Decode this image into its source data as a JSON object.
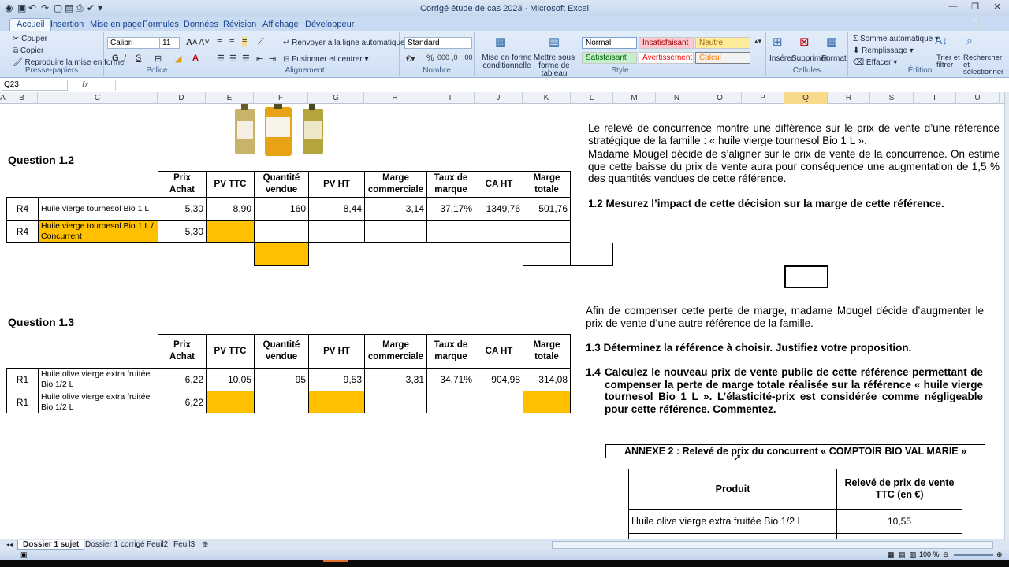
{
  "window": {
    "title": "Corrigé étude de cas 2023 - Microsoft Excel"
  },
  "tabs": [
    "Accueil",
    "Insertion",
    "Mise en page",
    "Formules",
    "Données",
    "Révision",
    "Affichage",
    "Développeur"
  ],
  "ribbon": {
    "clipboard": {
      "cut": "Couper",
      "copy": "Copier",
      "format_painter": "Reproduire la mise en forme",
      "label": "Presse-papiers"
    },
    "font": {
      "name": "Calibri",
      "size": "11",
      "label": "Police"
    },
    "alignment": {
      "wrap": "Renvoyer à la ligne automatiquement",
      "merge": "Fusionner et centrer",
      "label": "Alignement"
    },
    "number": {
      "format": "Standard",
      "label": "Nombre"
    },
    "conditional": "Mise en forme conditionnelle",
    "format_table": "Mettre sous forme de tableau",
    "styles": {
      "normal": "Normal",
      "insatisfaisant": "Insatisfaisant",
      "neutre": "Neutre",
      "satisfaisant": "Satisfaisant",
      "avertissement": "Avertissement",
      "calcul": "Calcul",
      "label": "Style"
    },
    "cells": {
      "insert": "Insérer",
      "delete": "Supprimer",
      "format": "Format",
      "label": "Cellules"
    },
    "editing": {
      "autosum": "Somme automatique",
      "fill": "Remplissage",
      "clear": "Effacer",
      "sort": "Trier et filtrer",
      "find": "Rechercher et sélectionner",
      "label": "Édition"
    }
  },
  "formula_bar": {
    "name_box": "Q23",
    "fx": "fx",
    "value": ""
  },
  "columns": [
    "A",
    "B",
    "C",
    "D",
    "E",
    "F",
    "G",
    "H",
    "I",
    "J",
    "K",
    "L",
    "M",
    "N",
    "O",
    "P",
    "Q",
    "R",
    "S",
    "T",
    "U"
  ],
  "selected_column": "Q",
  "headers": [
    "Prix Achat",
    "PV TTC",
    "Quantité vendue",
    "PV HT",
    "Marge commerciale",
    "Taux de marque",
    "CA HT",
    "Marge totale"
  ],
  "q12": {
    "title": "Question 1.2",
    "rows": [
      {
        "ref": "R4",
        "product": "Huile vierge tournesol Bio 1 L",
        "values": [
          "5,30",
          "8,90",
          "160",
          "8,44",
          "3,14",
          "37,17%",
          "1349,76",
          "501,76"
        ]
      },
      {
        "ref": "R4",
        "product": "Huile vierge tournesol Bio 1 L / Concurrent",
        "values": [
          "5,30",
          "",
          "",
          "",
          "",
          "",
          "",
          ""
        ]
      }
    ]
  },
  "q13": {
    "title": "Question 1.3",
    "rows": [
      {
        "ref": "R1",
        "product": "Huile olive vierge extra fruitée Bio 1/2 L",
        "values": [
          "6,22",
          "10,05",
          "95",
          "9,53",
          "3,31",
          "34,71%",
          "904,98",
          "314,08"
        ]
      },
      {
        "ref": "R1",
        "product": "Huile olive vierge extra fruitée Bio 1/2 L",
        "values": [
          "6,22",
          "",
          "",
          "",
          "",
          "",
          "",
          ""
        ]
      }
    ]
  },
  "text": {
    "p1": "Le relevé de concurrence montre une différence sur le prix de vente d’une référence stratégique de la famille : « huile vierge tournesol Bio 1 L ».",
    "p2": "Madame Mougel décide de s’aligner sur le prix de vente de la concurrence. On estime que cette baisse du prix de vente aura pour conséquence une augmentation de 1,5 % des quantités vendues de cette référence.",
    "q12": "1.2 Mesurez l’impact de cette décision sur la marge de cette référence.",
    "p3": "Afin de compenser cette perte de marge, madame Mougel décide d’augmenter le prix de vente d’une autre référence de la famille.",
    "q13": "1.3 Déterminez la référence à choisir. Justifiez votre proposition.",
    "q14_num": "1.4",
    "q14": "Calculez le nouveau prix de vente public de cette référence permettant de compenser la perte de marge totale réalisée sur la référence « huile vierge tournesol Bio 1 L ». L’élasticité-prix est considérée comme négligeable pour cette référence. Commentez."
  },
  "annexe": {
    "title": "ANNEXE 2 : Relevé de prix du concurrent « COMPTOIR BIO VAL MARIE »",
    "col1": "Produit",
    "col2": "Relevé de prix de vente TTC (en €)",
    "row1_product": "Huile olive vierge extra fruitée Bio 1/2 L",
    "row1_price": "10,55"
  },
  "sheets": [
    "Dossier 1 sujet",
    "Dossier 1 corrigé",
    "Feuil2",
    "Feuil3"
  ],
  "active_sheet": "Dossier 1 sujet",
  "zoom": "100 %"
}
